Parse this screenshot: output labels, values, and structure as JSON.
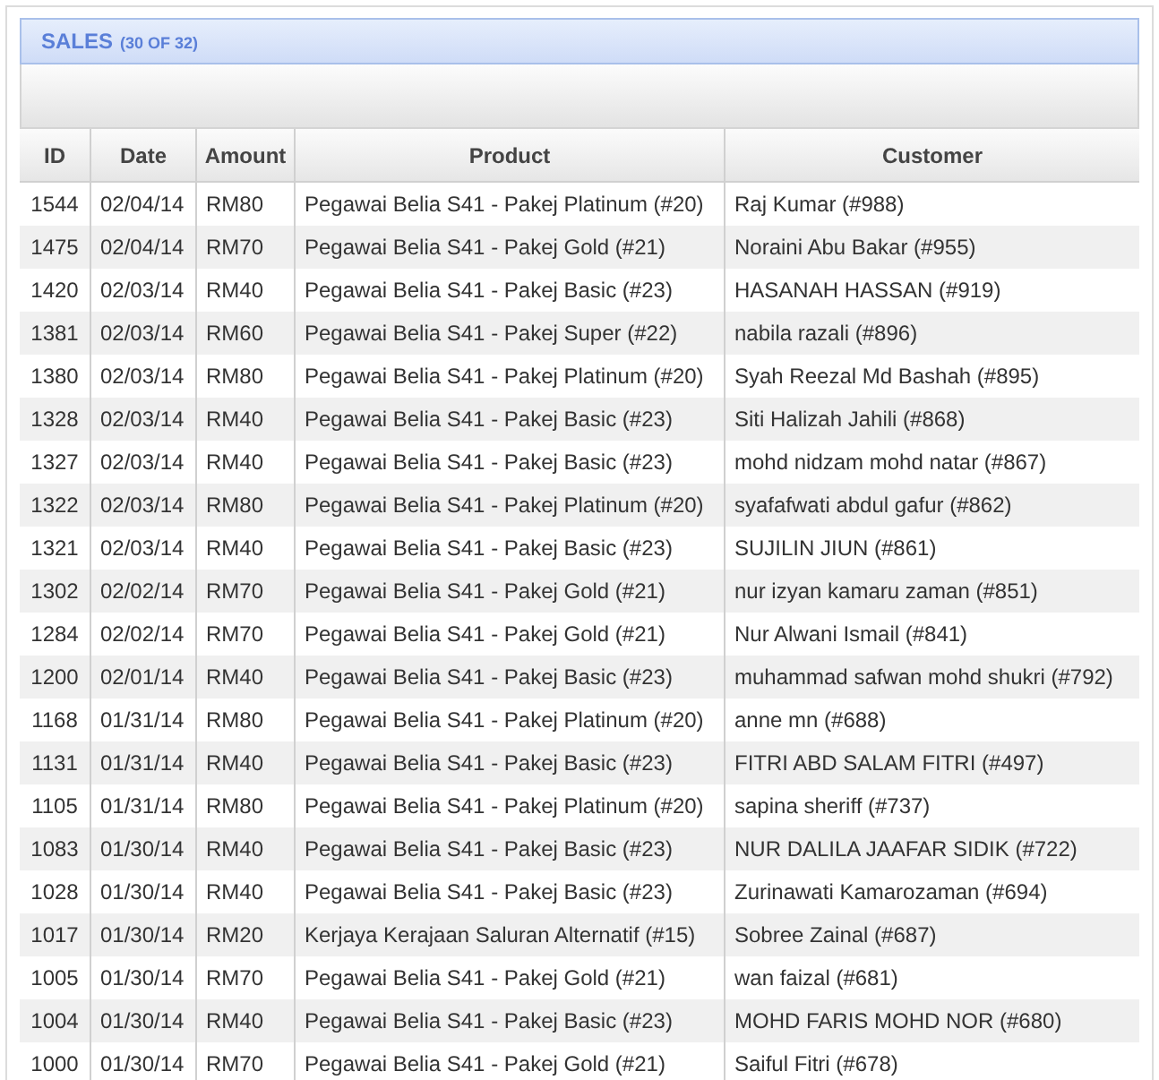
{
  "panel": {
    "title": "SALES",
    "count": "(30 OF 32)"
  },
  "table": {
    "columns": [
      "ID",
      "Date",
      "Amount",
      "Product",
      "Customer"
    ],
    "rows": [
      [
        "1544",
        "02/04/14",
        "RM80",
        "Pegawai Belia S41 - Pakej Platinum (#20)",
        "Raj Kumar (#988)"
      ],
      [
        "1475",
        "02/04/14",
        "RM70",
        "Pegawai Belia S41 - Pakej Gold (#21)",
        "Noraini Abu Bakar (#955)"
      ],
      [
        "1420",
        "02/03/14",
        "RM40",
        "Pegawai Belia S41 - Pakej Basic (#23)",
        "HASANAH HASSAN (#919)"
      ],
      [
        "1381",
        "02/03/14",
        "RM60",
        "Pegawai Belia S41 - Pakej Super (#22)",
        "nabila razali (#896)"
      ],
      [
        "1380",
        "02/03/14",
        "RM80",
        "Pegawai Belia S41 - Pakej Platinum (#20)",
        "Syah Reezal Md Bashah (#895)"
      ],
      [
        "1328",
        "02/03/14",
        "RM40",
        "Pegawai Belia S41 - Pakej Basic (#23)",
        "Siti Halizah Jahili (#868)"
      ],
      [
        "1327",
        "02/03/14",
        "RM40",
        "Pegawai Belia S41 - Pakej Basic (#23)",
        "mohd nidzam mohd natar (#867)"
      ],
      [
        "1322",
        "02/03/14",
        "RM80",
        "Pegawai Belia S41 - Pakej Platinum (#20)",
        "syafafwati abdul gafur (#862)"
      ],
      [
        "1321",
        "02/03/14",
        "RM40",
        "Pegawai Belia S41 - Pakej Basic (#23)",
        "SUJILIN JIUN (#861)"
      ],
      [
        "1302",
        "02/02/14",
        "RM70",
        "Pegawai Belia S41 - Pakej Gold (#21)",
        "nur izyan kamaru zaman (#851)"
      ],
      [
        "1284",
        "02/02/14",
        "RM70",
        "Pegawai Belia S41 - Pakej Gold (#21)",
        "Nur Alwani Ismail (#841)"
      ],
      [
        "1200",
        "02/01/14",
        "RM40",
        "Pegawai Belia S41 - Pakej Basic (#23)",
        "muhammad safwan mohd shukri (#792)"
      ],
      [
        "1168",
        "01/31/14",
        "RM80",
        "Pegawai Belia S41 - Pakej Platinum (#20)",
        "anne mn (#688)"
      ],
      [
        "1131",
        "01/31/14",
        "RM40",
        "Pegawai Belia S41 - Pakej Basic (#23)",
        "FITRI ABD SALAM FITRI (#497)"
      ],
      [
        "1105",
        "01/31/14",
        "RM80",
        "Pegawai Belia S41 - Pakej Platinum (#20)",
        "sapina sheriff (#737)"
      ],
      [
        "1083",
        "01/30/14",
        "RM40",
        "Pegawai Belia S41 - Pakej Basic (#23)",
        "NUR DALILA JAAFAR SIDIK (#722)"
      ],
      [
        "1028",
        "01/30/14",
        "RM40",
        "Pegawai Belia S41 - Pakej Basic (#23)",
        "Zurinawati Kamarozaman (#694)"
      ],
      [
        "1017",
        "01/30/14",
        "RM20",
        "Kerjaya Kerajaan Saluran Alternatif (#15)",
        "Sobree Zainal (#687)"
      ],
      [
        "1005",
        "01/30/14",
        "RM70",
        "Pegawai Belia S41 - Pakej Gold (#21)",
        "wan faizal (#681)"
      ],
      [
        "1004",
        "01/30/14",
        "RM40",
        "Pegawai Belia S41 - Pakej Basic (#23)",
        "MOHD FARIS MOHD NOR (#680)"
      ],
      [
        "1000",
        "01/30/14",
        "RM70",
        "Pegawai Belia S41 - Pakej Gold (#21)",
        "Saiful Fitri (#678)"
      ]
    ]
  }
}
